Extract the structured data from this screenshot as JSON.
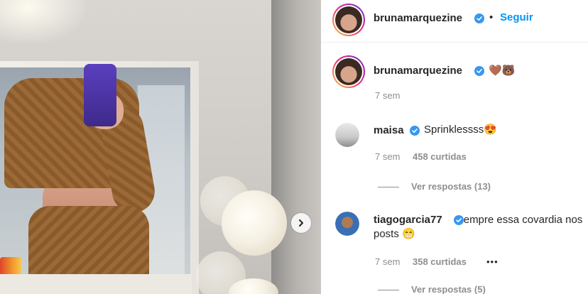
{
  "post_image": {
    "carousel_next_icon": "chevron-right-icon"
  },
  "header": {
    "username": "brunamarquezine",
    "verified_icon": "verified-badge-icon",
    "separator": "•",
    "follow_label": "Seguir"
  },
  "caption": {
    "username": "brunamarquezine",
    "text": "🤎🐻",
    "time": "7 sem"
  },
  "comments": [
    {
      "username": "maisa",
      "text": "Sprinklessss😍",
      "time": "7 sem",
      "likes": "458 curtidas",
      "replies": "Ver respostas (13)"
    },
    {
      "username": "tiagogarcia77",
      "text": "Sempre essa covardia nos posts 😁",
      "time": "7 sem",
      "likes": "358 curtidas",
      "more": "•••",
      "replies": "Ver respostas (5)"
    }
  ],
  "colors": {
    "link_blue": "#0095f6",
    "verified_blue": "#3897f0",
    "secondary_text": "#8e8e8e"
  }
}
